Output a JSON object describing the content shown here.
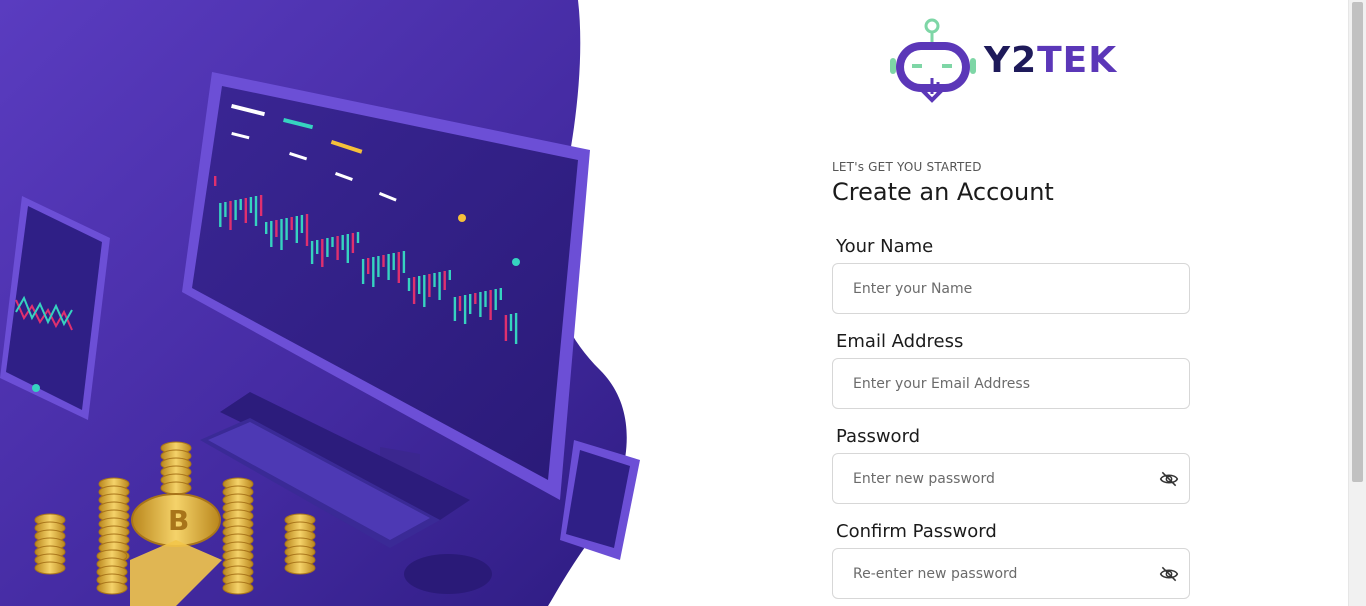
{
  "brand": {
    "name_part1": "Y2",
    "name_part2": "TEK"
  },
  "form": {
    "overline": "LET's GET YOU STARTED",
    "title": "Create an Account",
    "fields": [
      {
        "label": "Your Name",
        "placeholder": "Enter your Name",
        "value": ""
      },
      {
        "label": "Email Address",
        "placeholder": "Enter your Email Address",
        "value": ""
      },
      {
        "label": "Password",
        "placeholder": "Enter new password",
        "value": "",
        "icon": "eye-off-icon"
      },
      {
        "label": "Confirm Password",
        "placeholder": "Re-enter new password",
        "value": "",
        "icon": "eye-off-icon"
      }
    ]
  },
  "colors": {
    "hero_purple": "#4c2fa6",
    "hero_dark": "#2a1a78",
    "accent": "#5b37b8",
    "brand_dark": "#1e1a5a",
    "logo_green": "#7ed6a6",
    "candle_green": "#36d3c0",
    "candle_pink": "#e0306e",
    "coin_gold": "#e8b73a"
  }
}
